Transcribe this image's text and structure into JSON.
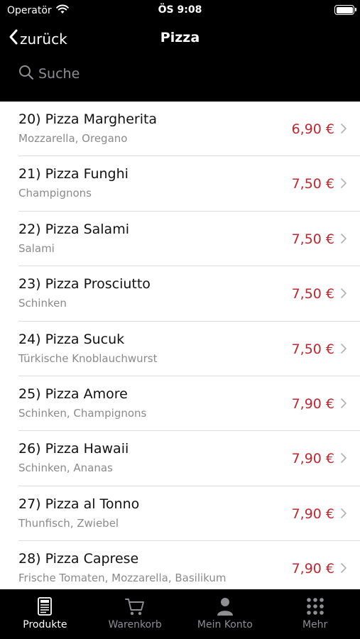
{
  "status_bar": {
    "carrier": "Operatör",
    "time": "ÖS 9:08"
  },
  "nav": {
    "back_label": "zurück",
    "title": "Pizza"
  },
  "search": {
    "placeholder": "Suche"
  },
  "products": [
    {
      "name": "20) Pizza Margherita",
      "description": "Mozzarella, Oregano",
      "price": "6,90 €"
    },
    {
      "name": "21) Pizza Funghi",
      "description": "Champignons",
      "price": "7,50 €"
    },
    {
      "name": "22) Pizza Salami",
      "description": "Salami",
      "price": "7,50 €"
    },
    {
      "name": "23) Pizza Prosciutto",
      "description": "Schinken",
      "price": "7,50 €"
    },
    {
      "name": "24) Pizza Sucuk",
      "description": "Türkische Knoblauchwurst",
      "price": "7,50 €"
    },
    {
      "name": "25) Pizza Amore",
      "description": "Schinken, Champignons",
      "price": "7,90 €"
    },
    {
      "name": "26) Pizza Hawaii",
      "description": "Schinken, Ananas",
      "price": "7,90 €"
    },
    {
      "name": "27) Pizza al Tonno",
      "description": "Thunfisch, Zwiebel",
      "price": "7,90 €"
    },
    {
      "name": "28) Pizza Caprese",
      "description": "Frische Tomaten, Mozzarella, Basilikum",
      "price": "7,90 €"
    }
  ],
  "tabbar": {
    "items": [
      {
        "label": "Produkte",
        "icon": "menu-card-icon",
        "active": true
      },
      {
        "label": "Warenkorb",
        "icon": "cart-icon",
        "active": false
      },
      {
        "label": "Mein Konto",
        "icon": "person-icon",
        "active": false
      },
      {
        "label": "Mehr",
        "icon": "grid-dots-icon",
        "active": false
      }
    ]
  },
  "colors": {
    "price": "#c0262d",
    "header_bg": "#000000",
    "active_tab": "#ffffff",
    "inactive_tab": "#8e8e93"
  }
}
